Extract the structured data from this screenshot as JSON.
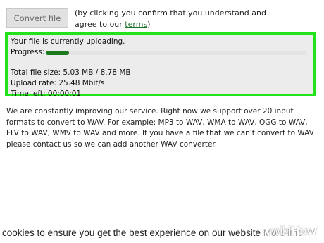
{
  "form": {
    "convert_button": "Convert file",
    "consent_prefix": "(by clicking you confirm that you understand and agree to our ",
    "terms_link": "terms",
    "consent_suffix": ")"
  },
  "upload": {
    "status": "Your file is currently uploading.",
    "progress_label": "Progress:",
    "progress_fraction": 0.09,
    "file_size": "Total file size: 5.03 MB / 8.78 MB",
    "upload_rate": "Upload rate: 25.48 Mbit/s",
    "time_left": "Time left: 00:00:01"
  },
  "description": "We are constantly improving our service. Right now we support over 20 input formats to convert to WAV. For example: MP3 to WAV, WMA to WAV, OGG to WAV, FLV to WAV, WMV to WAV and more. If you have a file that we can't convert to WAV please contact us so we can add another WAV converter.",
  "cookie_bar": {
    "text": "cookies to ensure you get the best experience on our website",
    "more_info": "More info"
  },
  "watermark": {
    "part1": "wiki",
    "part2": "How"
  },
  "colors": {
    "highlight_border": "#22e31a",
    "progress_fill": "#1e7a1e",
    "link": "#1a6f2a"
  }
}
